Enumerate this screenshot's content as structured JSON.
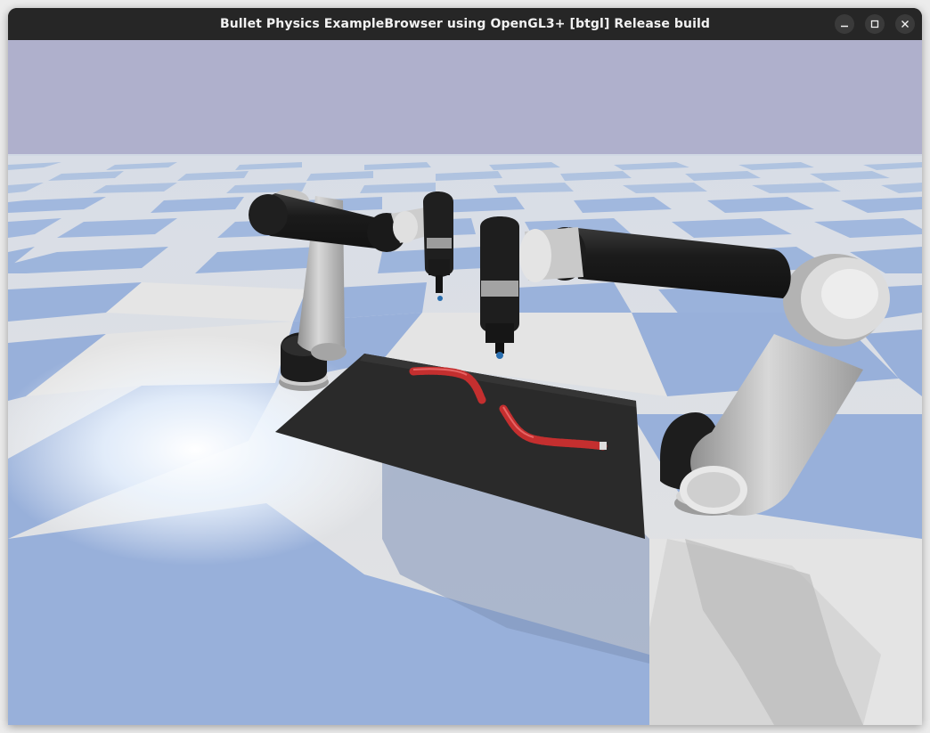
{
  "window": {
    "title": "Bullet Physics ExampleBrowser using OpenGL3+ [btgl] Release build",
    "buttons": {
      "minimize_icon": "minimize-icon",
      "maximize_icon": "maximize-icon",
      "close_icon": "close-icon"
    }
  },
  "scene": {
    "description_icon": "3d-render",
    "colors": {
      "sky": "#afb0cc",
      "floor_light": "#e2e2e2",
      "floor_blue": "#97afd8",
      "mat": "#2a2a2a",
      "rope": "#d93a3a",
      "robot_dark": "#1e1e1e",
      "robot_light": "#c8c8c8"
    }
  }
}
